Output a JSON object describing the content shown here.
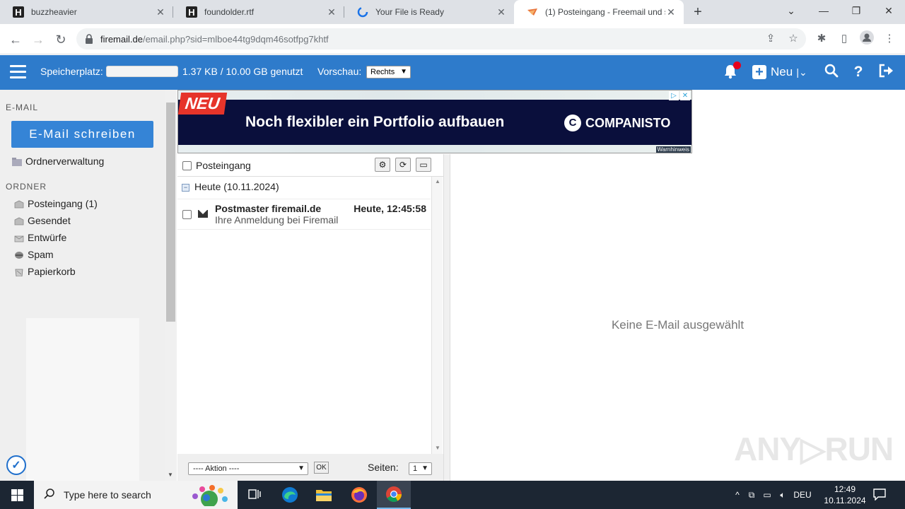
{
  "browser": {
    "tabs": [
      {
        "title": "buzzheavier",
        "favicon": "H"
      },
      {
        "title": "foundolder.rtf",
        "favicon": "H"
      },
      {
        "title": "Your File is Ready",
        "favicon": "loading-icon"
      },
      {
        "title": "(1) Posteingang - Freemail und s",
        "favicon": "freemail-icon"
      }
    ],
    "url_host": "firemail.de",
    "url_path": "/email.php?sid=mlboe44tg9dqm46sotfpg7khtf"
  },
  "header": {
    "storage_label": "Speicherplatz:",
    "storage_value": "1.37 KB / 10.00 GB genutzt",
    "storage_fraction": 0.0,
    "preview_label": "Vorschau:",
    "preview_value": "Rechts",
    "new_label": "Neu",
    "accent": "#2e7bcb"
  },
  "sidebar": {
    "email_section": "E-MAIL",
    "compose_label": "E-Mail schreiben",
    "folder_mgmt_label": "Ordnerverwaltung",
    "folders_section": "ORDNER",
    "folders": [
      {
        "name": "Posteingang",
        "count": "(1)"
      },
      {
        "name": "Gesendet",
        "count": ""
      },
      {
        "name": "Entwürfe",
        "count": ""
      },
      {
        "name": "Spam",
        "count": ""
      },
      {
        "name": "Papierkorb",
        "count": ""
      }
    ]
  },
  "ad": {
    "badge": "NEU",
    "headline": "Noch flexibler ein Portfolio aufbauen",
    "brand": "COMPANISTO",
    "warn": "Warnhinweis"
  },
  "maillist": {
    "folder_label": "Posteingang",
    "group_label": "Heute (10.11.2024)",
    "messages": [
      {
        "sender": "Postmaster firemail.de",
        "date": "Heute, 12:45:58",
        "subject": "Ihre Anmeldung bei Firemail"
      }
    ],
    "action_placeholder": "---- Aktion ----",
    "ok_label": "OK",
    "pages_label": "Seiten:",
    "page_value": "1"
  },
  "preview": {
    "empty_text": "Keine E-Mail ausgewählt"
  },
  "taskbar": {
    "search_placeholder": "Type here to search",
    "language": "DEU",
    "time": "12:49",
    "date": "10.11.2024"
  }
}
